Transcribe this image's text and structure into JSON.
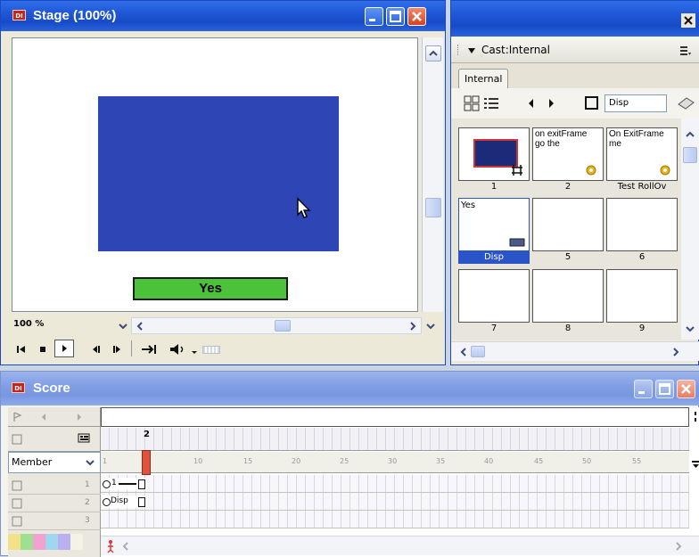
{
  "stage": {
    "title": "Stage (100%)",
    "button_label": "Yes",
    "zoom": "100 %"
  },
  "cast": {
    "header": "Cast:Internal",
    "tab": "Internal",
    "member_name_field": "Disp",
    "members": [
      {
        "num": "1",
        "text": ""
      },
      {
        "num": "2",
        "text": "on exitFrame\ngo the"
      },
      {
        "num": "Test RollOv",
        "text": "On ExitFrame me"
      },
      {
        "num": "Disp",
        "text": "Yes",
        "selected": true
      },
      {
        "num": "5",
        "text": ""
      },
      {
        "num": "6",
        "text": ""
      },
      {
        "num": "7",
        "text": ""
      },
      {
        "num": "8",
        "text": ""
      },
      {
        "num": "9",
        "text": ""
      }
    ]
  },
  "score": {
    "title": "Score",
    "member_dropdown": "Member",
    "frame_marker": "2",
    "ruler_ticks": [
      "1",
      "10",
      "15",
      "20",
      "25",
      "30",
      "35",
      "40",
      "45",
      "50",
      "55"
    ],
    "channels": [
      {
        "num": "1",
        "sprite_label": "1"
      },
      {
        "num": "2",
        "sprite_label": "Disp"
      },
      {
        "num": "3",
        "sprite_label": ""
      }
    ]
  },
  "icons": [
    "director-logo",
    "minimize-icon",
    "maximize-icon",
    "close-icon",
    "rewind-icon",
    "stop-icon",
    "play-icon",
    "step-back-icon",
    "step-forward-icon",
    "loop-icon",
    "volume-icon",
    "mouse-cursor-icon",
    "playhead-icon"
  ],
  "colors": {
    "titlebar": "#1f57d6",
    "stage_rect": "#2d45b5",
    "yes_button": "#4cc23a",
    "selection": "#2c54c9",
    "playhead": "#e0523c"
  }
}
